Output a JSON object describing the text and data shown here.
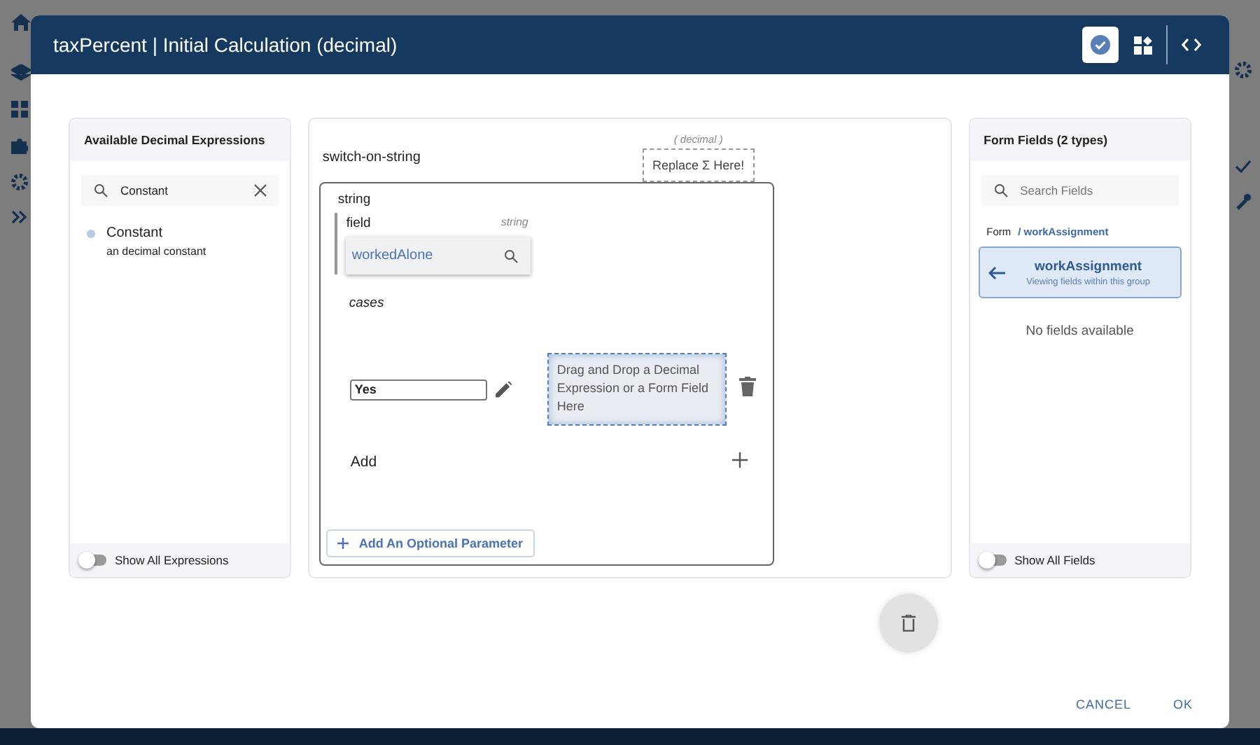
{
  "dialog": {
    "title": "taxPercent | Initial Calculation (decimal)",
    "view_buttons": [
      {
        "kind": "check",
        "selected": true
      },
      {
        "kind": "blocks",
        "selected": false
      },
      {
        "kind": "code",
        "selected": false
      }
    ]
  },
  "expressions_panel": {
    "title": "Available Decimal Expressions",
    "search": {
      "value": "Constant"
    },
    "items": [
      {
        "name": "Constant",
        "description": "an decimal constant"
      }
    ],
    "toggle": {
      "label": "Show All Expressions",
      "on": false
    }
  },
  "editor": {
    "expression": "switch-on-string",
    "type_hint": "( decimal )",
    "drop_slot": "Replace Σ Here!",
    "param_label": "string",
    "field": {
      "label": "field",
      "type_hint": "string",
      "value": "workedAlone"
    },
    "cases_label": "cases",
    "cases": [
      {
        "value": "Yes",
        "drop_hint": "Drag and Drop a Decimal Expression or a Form Field Here"
      }
    ],
    "add_label": "Add",
    "optional_button": "Add An Optional Parameter"
  },
  "fields_panel": {
    "title": "Form Fields (2 types)",
    "search": {
      "placeholder": "Search Fields"
    },
    "breadcrumb": {
      "root": "Form",
      "path": "/ workAssignment"
    },
    "group": {
      "name": "workAssignment",
      "subtitle": "Viewing fields within this group"
    },
    "empty": "No fields available",
    "toggle": {
      "label": "Show All Fields",
      "on": false
    }
  },
  "actions": [
    "CANCEL",
    "OK"
  ]
}
